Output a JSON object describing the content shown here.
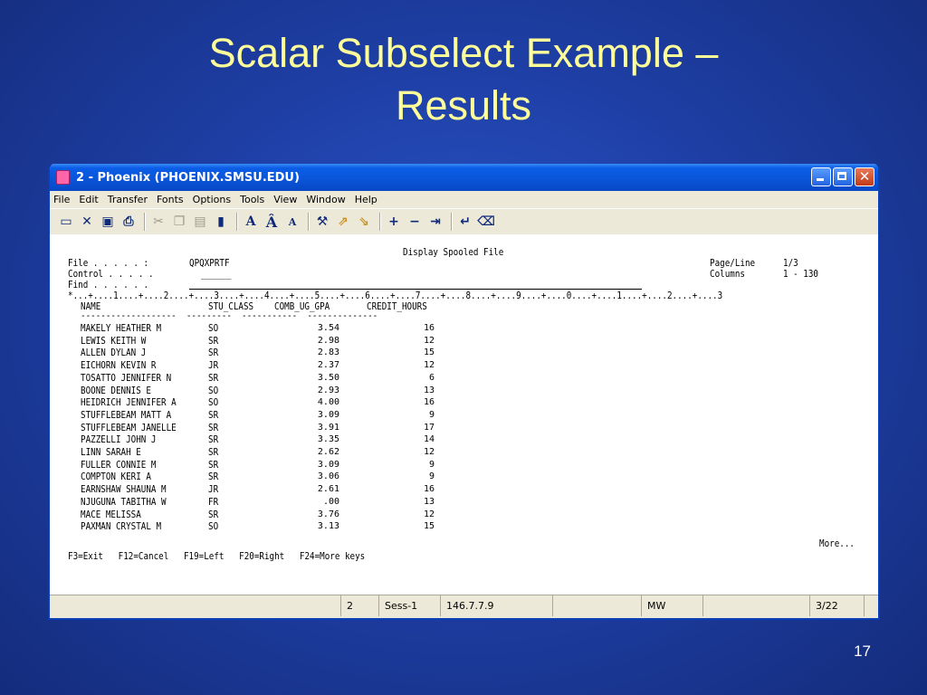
{
  "slide": {
    "title_line1": "Scalar Subselect Example –",
    "title_line2": "Results",
    "page_number": "17"
  },
  "window": {
    "title": "2 - Phoenix (PHOENIX.SMSU.EDU)",
    "menus": [
      "File",
      "Edit",
      "Transfer",
      "Fonts",
      "Options",
      "Tools",
      "View",
      "Window",
      "Help"
    ]
  },
  "toolbar": {
    "icons": [
      "monitor-icon",
      "disconnect-icon",
      "save-icon",
      "print-icon",
      "cut-icon",
      "copy-icon",
      "paste-icon",
      "keyboard-icon",
      "font-icon",
      "font-larger-icon",
      "font-smaller-icon",
      "tools-icon",
      "send-file-icon",
      "receive-file-icon",
      "plus-icon",
      "minus-icon",
      "tab-icon",
      "enter-icon",
      "erase-icon"
    ]
  },
  "terminal": {
    "header_title": "Display Spooled File",
    "file_label": "File . . . . . :",
    "file_value": "QPQXPRTF",
    "control_label": "Control . . . . .",
    "control_value": "______",
    "find_label": "Find . . . . . .",
    "page_line_label": "Page/Line",
    "page_line_value": "1/3",
    "columns_label": "Columns",
    "columns_value": "1 - 130",
    "ruler": "*...+....1....+....2....+....3....+....4....+....5....+....6....+....7....+....8....+....9....+....0....+....1....+....2....+....3",
    "columns": [
      "NAME",
      "STU_CLASS",
      "COMB_UG_GPA",
      "CREDIT_HOURS"
    ],
    "rows": [
      [
        "MAKELY HEATHER M",
        "SO",
        "3.54",
        "16"
      ],
      [
        "LEWIS KEITH W",
        "SR",
        "2.98",
        "12"
      ],
      [
        "ALLEN DYLAN J",
        "SR",
        "2.83",
        "15"
      ],
      [
        "EICHORN KEVIN R",
        "JR",
        "2.37",
        "12"
      ],
      [
        "TOSATTO JENNIFER N",
        "SR",
        "3.50",
        "6"
      ],
      [
        "BOONE DENNIS E",
        "SO",
        "2.93",
        "13"
      ],
      [
        "HEIDRICH JENNIFER A",
        "SO",
        "4.00",
        "16"
      ],
      [
        "STUFFLEBEAM MATT A",
        "SR",
        "3.09",
        "9"
      ],
      [
        "STUFFLEBEAM JANELLE",
        "SR",
        "3.91",
        "17"
      ],
      [
        "PAZZELLI JOHN J",
        "SR",
        "3.35",
        "14"
      ],
      [
        "LINN SARAH E",
        "SR",
        "2.62",
        "12"
      ],
      [
        "FULLER CONNIE M",
        "SR",
        "3.09",
        "9"
      ],
      [
        "COMPTON KERI A",
        "SR",
        "3.06",
        "9"
      ],
      [
        "EARNSHAW SHAUNA M",
        "JR",
        "2.61",
        "16"
      ],
      [
        "NJUGUNA TABITHA W",
        "FR",
        ".00",
        "13"
      ],
      [
        "MACE MELISSA",
        "SR",
        "3.76",
        "12"
      ],
      [
        "PAXMAN CRYSTAL M",
        "SO",
        "3.13",
        "15"
      ]
    ],
    "more": "More...",
    "function_keys": "F3=Exit   F12=Cancel   F19=Left   F20=Right   F24=More keys"
  },
  "statusbar": {
    "screen_num": "2",
    "session": "Sess-1",
    "host": "146.7.7.9",
    "mode": "MW",
    "cursor": "3/22"
  }
}
